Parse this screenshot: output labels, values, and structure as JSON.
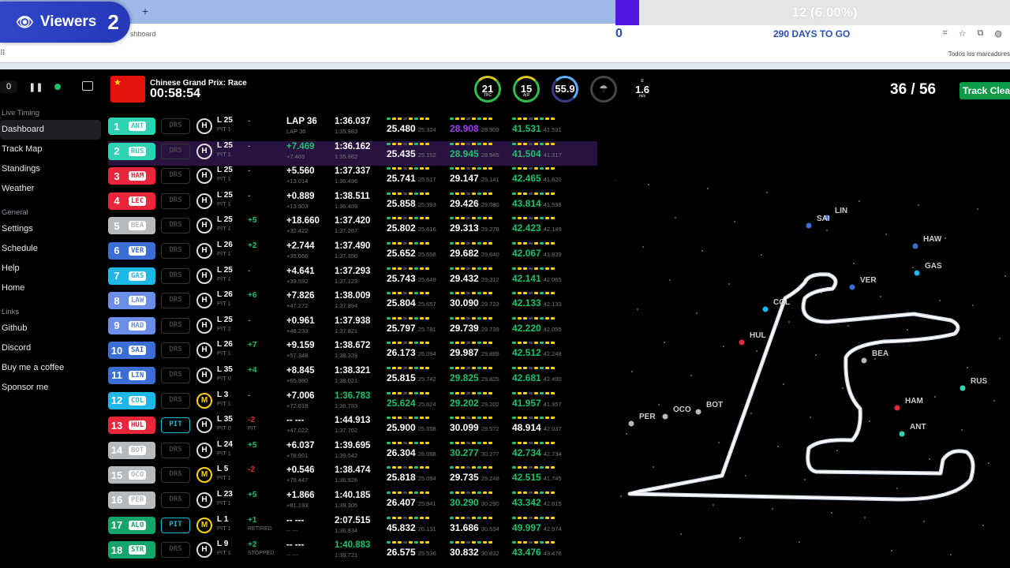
{
  "browser": {
    "url_fragment": "shboard",
    "bookmarks_label": "Todos los marcadores",
    "new_tab": "+"
  },
  "overlay": {
    "viewers_label": "Viewers",
    "viewers_count": "2",
    "progress_text": "12 (6.00%)",
    "progress_fraction": 0.06,
    "counter": "0",
    "days_to_go": "290 DAYS TO GO"
  },
  "header": {
    "speed_value": "0",
    "race_name": "Chinese Grand Prix: Race",
    "clock": "00:58:54",
    "laps": "36 / 56",
    "track_status": "Track Clear"
  },
  "weather": {
    "track_temp": "21",
    "track_label": "TRC",
    "air_temp": "15",
    "air_label": "AIR",
    "humidity": "55.9",
    "wind_speed": "1.6",
    "wind_unit": "m/s",
    "wind_dir": "E"
  },
  "sidebar": {
    "sections": [
      {
        "title": "Live Timing",
        "items": [
          "Dashboard",
          "Track Map",
          "Standings",
          "Weather"
        ]
      },
      {
        "title": "General",
        "items": [
          "Settings",
          "Schedule",
          "Help",
          "Home"
        ]
      },
      {
        "title": "Links",
        "items": [
          "Github",
          "Discord",
          "Buy me a coffee",
          "Sponsor me"
        ]
      }
    ]
  },
  "drivers": [
    {
      "pos": "1",
      "tla": "ANT",
      "color": "#2ed3b2",
      "drs": "DRS",
      "tyre": "H",
      "lap": "L 25",
      "pit": "PIT 1",
      "pd": "-",
      "gap": "LAP 36",
      "gap2": "LAP 36",
      "last": "1:36.037",
      "last2": "1:35.983",
      "s1": "25.480",
      "s1p": "25.324",
      "s1c": "w",
      "s2": "28.908",
      "s2p": "28.908",
      "s2c": "p",
      "s3": "41.531",
      "s3p": "41.531",
      "s3c": "g"
    },
    {
      "pos": "2",
      "tla": "RUS",
      "color": "#2ed3b2",
      "drs": "DRS",
      "tyre": "H",
      "lap": "L 25",
      "pit": "PIT 1",
      "pd": "-",
      "gap": "+7.469",
      "gap2": "+7.469",
      "last": "1:36.162",
      "last2": "1:35.882",
      "s1": "25.435",
      "s1p": "25.152",
      "s1c": "w",
      "s2": "28.945",
      "s2p": "28.945",
      "s2c": "g",
      "s3": "41.504",
      "s3p": "41.317",
      "s3c": "g"
    },
    {
      "pos": "3",
      "tla": "HAM",
      "color": "#e8283a",
      "drs": "DRS",
      "tyre": "H",
      "lap": "L 25",
      "pit": "PIT 1",
      "pd": "-",
      "gap": "+5.560",
      "gap2": "+13.014",
      "last": "1:37.337",
      "last2": "1:36.496",
      "s1": "25.741",
      "s1p": "25.517",
      "s1c": "w",
      "s2": "29.147",
      "s2p": "29.141",
      "s2c": "w",
      "s3": "42.465",
      "s3p": "41.620",
      "s3c": "g"
    },
    {
      "pos": "4",
      "tla": "LEC",
      "color": "#e8283a",
      "drs": "DRS",
      "tyre": "H",
      "lap": "L 25",
      "pit": "PIT 1",
      "pd": "-",
      "gap": "+0.889",
      "gap2": "+13.903",
      "last": "1:38.511",
      "last2": "1:36.409",
      "s1": "25.858",
      "s1p": "25.393",
      "s1c": "w",
      "s2": "29.426",
      "s2p": "29.080",
      "s2c": "w",
      "s3": "43.814",
      "s3p": "41.598",
      "s3c": "g"
    },
    {
      "pos": "5",
      "tla": "BEA",
      "color": "#b6babd",
      "drs": "DRS",
      "tyre": "H",
      "lap": "L 25",
      "pit": "PIT 1",
      "pd": "+5",
      "gap": "+18.660",
      "gap2": "+32.422",
      "last": "1:37.420",
      "last2": "1:37.267",
      "s1": "25.802",
      "s1p": "25.616",
      "s1c": "w",
      "s2": "29.313",
      "s2p": "29.278",
      "s2c": "w",
      "s3": "42.423",
      "s3p": "42.149",
      "s3c": "g"
    },
    {
      "pos": "6",
      "tla": "VER",
      "color": "#3b6fd6",
      "drs": "DRS",
      "tyre": "H",
      "lap": "L 26",
      "pit": "PIT 1",
      "pd": "+2",
      "gap": "+2.744",
      "gap2": "+35.066",
      "last": "1:37.490",
      "last2": "1:37.350",
      "s1": "25.652",
      "s1p": "25.558",
      "s1c": "w",
      "s2": "29.682",
      "s2p": "29.640",
      "s2c": "w",
      "s3": "42.067",
      "s3p": "41.839",
      "s3c": "g"
    },
    {
      "pos": "7",
      "tla": "GAS",
      "color": "#1fb6e8",
      "drs": "DRS",
      "tyre": "H",
      "lap": "L 25",
      "pit": "PIT 1",
      "pd": "-",
      "gap": "+4.641",
      "gap2": "+39.592",
      "last": "1:37.293",
      "last2": "1:37.123",
      "s1": "25.743",
      "s1p": "25.649",
      "s1c": "w",
      "s2": "29.432",
      "s2p": "29.312",
      "s2c": "w",
      "s3": "42.141",
      "s3p": "42.065",
      "s3c": "g"
    },
    {
      "pos": "8",
      "tla": "LAW",
      "color": "#6b8ee8",
      "drs": "DRS",
      "tyre": "H",
      "lap": "L 26",
      "pit": "PIT 1",
      "pd": "+6",
      "gap": "+7.826",
      "gap2": "+47.272",
      "last": "1:38.009",
      "last2": "1:37.894",
      "s1": "25.804",
      "s1p": "25.657",
      "s1c": "w",
      "s2": "30.090",
      "s2p": "29.723",
      "s2c": "w",
      "s3": "42.133",
      "s3p": "42.133",
      "s3c": "g"
    },
    {
      "pos": "9",
      "tla": "HAD",
      "color": "#6b8ee8",
      "drs": "DRS",
      "tyre": "H",
      "lap": "L 25",
      "pit": "PIT 2",
      "pd": "-",
      "gap": "+0.961",
      "gap2": "+48.233",
      "last": "1:37.938",
      "last2": "1:37.821",
      "s1": "25.797",
      "s1p": "25.781",
      "s1c": "w",
      "s2": "29.739",
      "s2p": "29.739",
      "s2c": "w",
      "s3": "42.220",
      "s3p": "42.055",
      "s3c": "g"
    },
    {
      "pos": "10",
      "tla": "SAI",
      "color": "#3b6fd6",
      "drs": "DRS",
      "tyre": "H",
      "lap": "L 26",
      "pit": "PIT 1",
      "pd": "+7",
      "gap": "+9.159",
      "gap2": "+57.348",
      "last": "1:38.672",
      "last2": "1:38.339",
      "s1": "26.173",
      "s1p": "26.094",
      "s1c": "w",
      "s2": "29.987",
      "s2p": "29.889",
      "s2c": "w",
      "s3": "42.512",
      "s3p": "42.248",
      "s3c": "g"
    },
    {
      "pos": "11",
      "tla": "LIN",
      "color": "#3b6fd6",
      "drs": "DRS",
      "tyre": "H",
      "lap": "L 35",
      "pit": "PIT 0",
      "pd": "+4",
      "gap": "+8.845",
      "gap2": "+65.980",
      "last": "1:38.321",
      "last2": "1:38.021",
      "s1": "25.815",
      "s1p": "25.742",
      "s1c": "w",
      "s2": "29.825",
      "s2p": "29.825",
      "s2c": "g",
      "s3": "42.681",
      "s3p": "42.490",
      "s3c": "g"
    },
    {
      "pos": "12",
      "tla": "COL",
      "color": "#1fb6e8",
      "drs": "DRS",
      "tyre": "M",
      "lap": "L 3",
      "pit": "PIT 1",
      "pd": "-",
      "gap": "+7.006",
      "gap2": "+72.818",
      "last": "1:36.783",
      "last2": "1:36.783",
      "s1": "25.624",
      "s1p": "25.624",
      "s1c": "g",
      "s2": "29.202",
      "s2p": "29.202",
      "s2c": "g",
      "s3": "41.957",
      "s3p": "41.957",
      "s3c": "g"
    },
    {
      "pos": "13",
      "tla": "HUL",
      "color": "#e8283a",
      "drs": "PIT",
      "tyre": "H",
      "lap": "L 35",
      "pit": "PIT 0",
      "pd": "-2",
      "pd2": "PIT",
      "gap": "-- ---",
      "gap2": "+47.022",
      "last": "1:44.913",
      "last2": "1:37.762",
      "s1": "25.900",
      "s1p": "25.658",
      "s1c": "w",
      "s2": "30.099",
      "s2p": "29.572",
      "s2c": "w",
      "s3": "48.914",
      "s3p": "42.037",
      "s3c": "w"
    },
    {
      "pos": "14",
      "tla": "BOT",
      "color": "#b6babd",
      "drs": "DRS",
      "tyre": "H",
      "lap": "L 24",
      "pit": "PIT 1",
      "pd": "+5",
      "gap": "+6.037",
      "gap2": "+78.901",
      "last": "1:39.695",
      "last2": "1:39.542",
      "s1": "26.304",
      "s1p": "26.098",
      "s1c": "w",
      "s2": "30.277",
      "s2p": "30.277",
      "s2c": "g",
      "s3": "42.734",
      "s3p": "42.734",
      "s3c": "g"
    },
    {
      "pos": "15",
      "tla": "OCO",
      "color": "#b6babd",
      "drs": "DRS",
      "tyre": "M",
      "lap": "L 5",
      "pit": "PIT 1",
      "pd": "-2",
      "gap": "+0.546",
      "gap2": "+79.447",
      "last": "1:38.474",
      "last2": "1:36.926",
      "s1": "25.818",
      "s1p": "25.094",
      "s1c": "w",
      "s2": "29.735",
      "s2p": "29.248",
      "s2c": "w",
      "s3": "42.515",
      "s3p": "41.745",
      "s3c": "g"
    },
    {
      "pos": "16",
      "tla": "PER",
      "color": "#b6babd",
      "drs": "DRS",
      "tyre": "H",
      "lap": "L 23",
      "pit": "PIT 1",
      "pd": "+5",
      "gap": "+1.866",
      "gap2": "+81.193",
      "last": "1:40.185",
      "last2": "1:39.305",
      "s1": "26.407",
      "s1p": "25.941",
      "s1c": "w",
      "s2": "30.290",
      "s2p": "30.290",
      "s2c": "g",
      "s3": "43.342",
      "s3p": "42.615",
      "s3c": "g"
    },
    {
      "pos": "17",
      "tla": "ALO",
      "color": "#16a56a",
      "drs": "PIT",
      "tyre": "M",
      "lap": "L 1",
      "pit": "PIT 1",
      "pd": "+1",
      "pd2": "RETIRED",
      "gap": "-- ---",
      "gap2": "-- ---",
      "last": "2:07.515",
      "last2": "1:36.834",
      "s1": "45.832",
      "s1p": "26.131",
      "s1c": "w",
      "s2": "31.686",
      "s2p": "30.534",
      "s2c": "w",
      "s3": "49.997",
      "s3p": "42.974",
      "s3c": "g"
    },
    {
      "pos": "18",
      "tla": "STR",
      "color": "#16a56a",
      "drs": "DRS",
      "tyre": "H",
      "lap": "L 9",
      "pit": "PIT 1",
      "pd": "+2",
      "pd2": "STOPPED",
      "gap": "-- ---",
      "gap2": "-- ---",
      "last": "1:40.883",
      "last2": "1:39.721",
      "s1": "26.575",
      "s1p": "25.536",
      "s1c": "w",
      "s2": "30.832",
      "s2p": "30.832",
      "s2c": "w",
      "s3": "43.476",
      "s3p": "43.476",
      "s3c": "g"
    }
  ],
  "map_labels": [
    "LIN",
    "SAI",
    "HAW",
    "GAS",
    "VER",
    "COL",
    "HUL",
    "BEA",
    "HAM",
    "RUS",
    "ANT",
    "OCO",
    "BOT",
    "PER"
  ],
  "colors": {
    "green": "#19c26b",
    "purple": "#a23cff",
    "yellow": "#ffd400",
    "track": "#ffffff"
  }
}
